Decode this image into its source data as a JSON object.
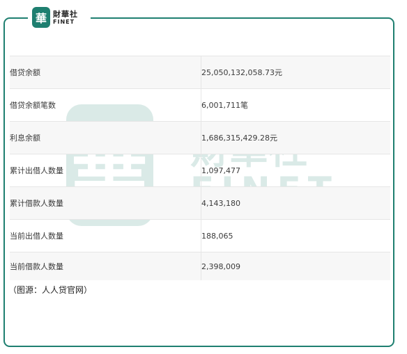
{
  "logo": {
    "seal_char": "華",
    "brand_cn": "財華社",
    "brand_en": "FINET"
  },
  "watermark": {
    "seal_char": "華",
    "brand_cn": "財華社",
    "brand_en": "FINET"
  },
  "table": {
    "rows": [
      {
        "label": "借贷余额",
        "value": "25,050,132,058.73元"
      },
      {
        "label": "借贷余额笔数",
        "value": "6,001,711笔"
      },
      {
        "label": "利息余额",
        "value": "1,686,315,429.28元"
      },
      {
        "label": "累计出借人数量",
        "value": "1,097,477"
      },
      {
        "label": "累计借款人数量",
        "value": "4,143,180"
      },
      {
        "label": "当前出借人数量",
        "value": "188,065"
      },
      {
        "label": "当前借款人数量",
        "value": "2,398,009"
      }
    ]
  },
  "source_note": "（图源：人人贷官网）",
  "colors": {
    "brand_teal": "#1e7f70"
  }
}
